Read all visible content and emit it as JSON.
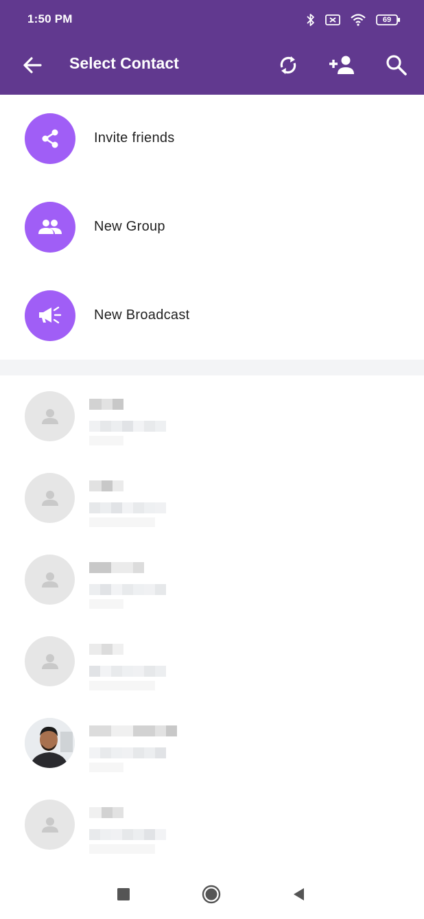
{
  "status_bar": {
    "time": "1:50 PM",
    "battery": "69",
    "icons": [
      "bluetooth-icon",
      "no-sim-icon",
      "wifi-icon",
      "battery-icon"
    ]
  },
  "app_bar": {
    "title": "Select Contact",
    "background_color": "#61398f",
    "actions": [
      "refresh-icon",
      "add-contact-icon",
      "search-icon"
    ]
  },
  "menu": [
    {
      "label": "Invite friends",
      "icon": "share-icon"
    },
    {
      "label": "New Group",
      "icon": "group-icon"
    },
    {
      "label": "New Broadcast",
      "icon": "broadcast-icon"
    }
  ],
  "accent_color": "#a05ef6",
  "contacts": [
    {
      "avatar": "person-placeholder-icon",
      "name_redacted": true,
      "phone_redacted": true
    },
    {
      "avatar": "person-placeholder-icon",
      "name_redacted": true,
      "phone_redacted": true
    },
    {
      "avatar": "person-placeholder-icon",
      "name_redacted": true,
      "phone_redacted": true
    },
    {
      "avatar": "person-placeholder-icon",
      "name_redacted": true,
      "phone_redacted": true
    },
    {
      "avatar": "profile-photo",
      "name_redacted": true,
      "phone_redacted": true
    },
    {
      "avatar": "person-placeholder-icon",
      "name_redacted": true,
      "phone_redacted": true
    }
  ],
  "nav_bar": [
    "recents-button",
    "home-button",
    "back-button"
  ]
}
